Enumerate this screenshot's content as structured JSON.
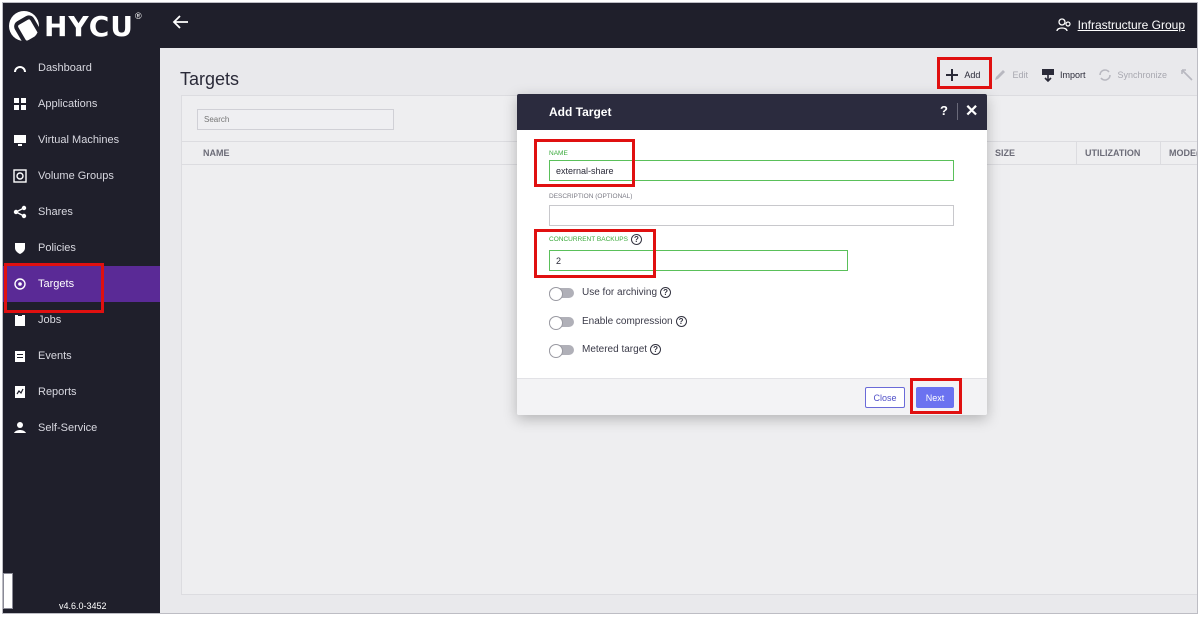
{
  "brand": {
    "name": "HYCU",
    "reg": "®"
  },
  "header": {
    "group_label": "Infrastructure Group"
  },
  "sidebar": {
    "items": [
      {
        "label": "Dashboard",
        "icon": "dashboard-icon"
      },
      {
        "label": "Applications",
        "icon": "applications-icon"
      },
      {
        "label": "Virtual Machines",
        "icon": "monitor-icon"
      },
      {
        "label": "Volume Groups",
        "icon": "volume-icon"
      },
      {
        "label": "Shares",
        "icon": "share-icon"
      },
      {
        "label": "Policies",
        "icon": "shield-icon"
      },
      {
        "label": "Targets",
        "icon": "target-icon",
        "active": true
      },
      {
        "label": "Jobs",
        "icon": "clipboard-icon"
      },
      {
        "label": "Events",
        "icon": "calendar-icon"
      },
      {
        "label": "Reports",
        "icon": "report-icon"
      },
      {
        "label": "Self-Service",
        "icon": "user-service-icon"
      }
    ],
    "version": "v4.6.0-3452"
  },
  "main": {
    "title": "Targets",
    "toolbar": {
      "add": "Add",
      "edit": "Edit",
      "import": "Import",
      "synchronize": "Synchronize"
    },
    "search_placeholder": "Search",
    "columns": [
      "NAME",
      "SIZE",
      "UTILIZATION",
      "MODE("
    ]
  },
  "modal": {
    "title": "Add Target",
    "help": "?",
    "close_glyph": "✕",
    "name_label": "NAME",
    "name_value": "external-share",
    "description_label": "DESCRIPTION (OPTIONAL)",
    "description_value": "",
    "concurrent_label": "CONCURRENT BACKUPS",
    "concurrent_value": "2",
    "toggles": [
      {
        "label": "Use for archiving",
        "on": false
      },
      {
        "label": "Enable compression",
        "on": false
      },
      {
        "label": "Metered target",
        "on": false
      }
    ],
    "close_button": "Close",
    "next_button": "Next"
  },
  "colors": {
    "sidebar_bg": "#1f1f2b",
    "active_nav": "#5a2a96",
    "accent_green": "#39a93a",
    "primary_button": "#6b72f0",
    "highlight_red": "#e01010"
  }
}
